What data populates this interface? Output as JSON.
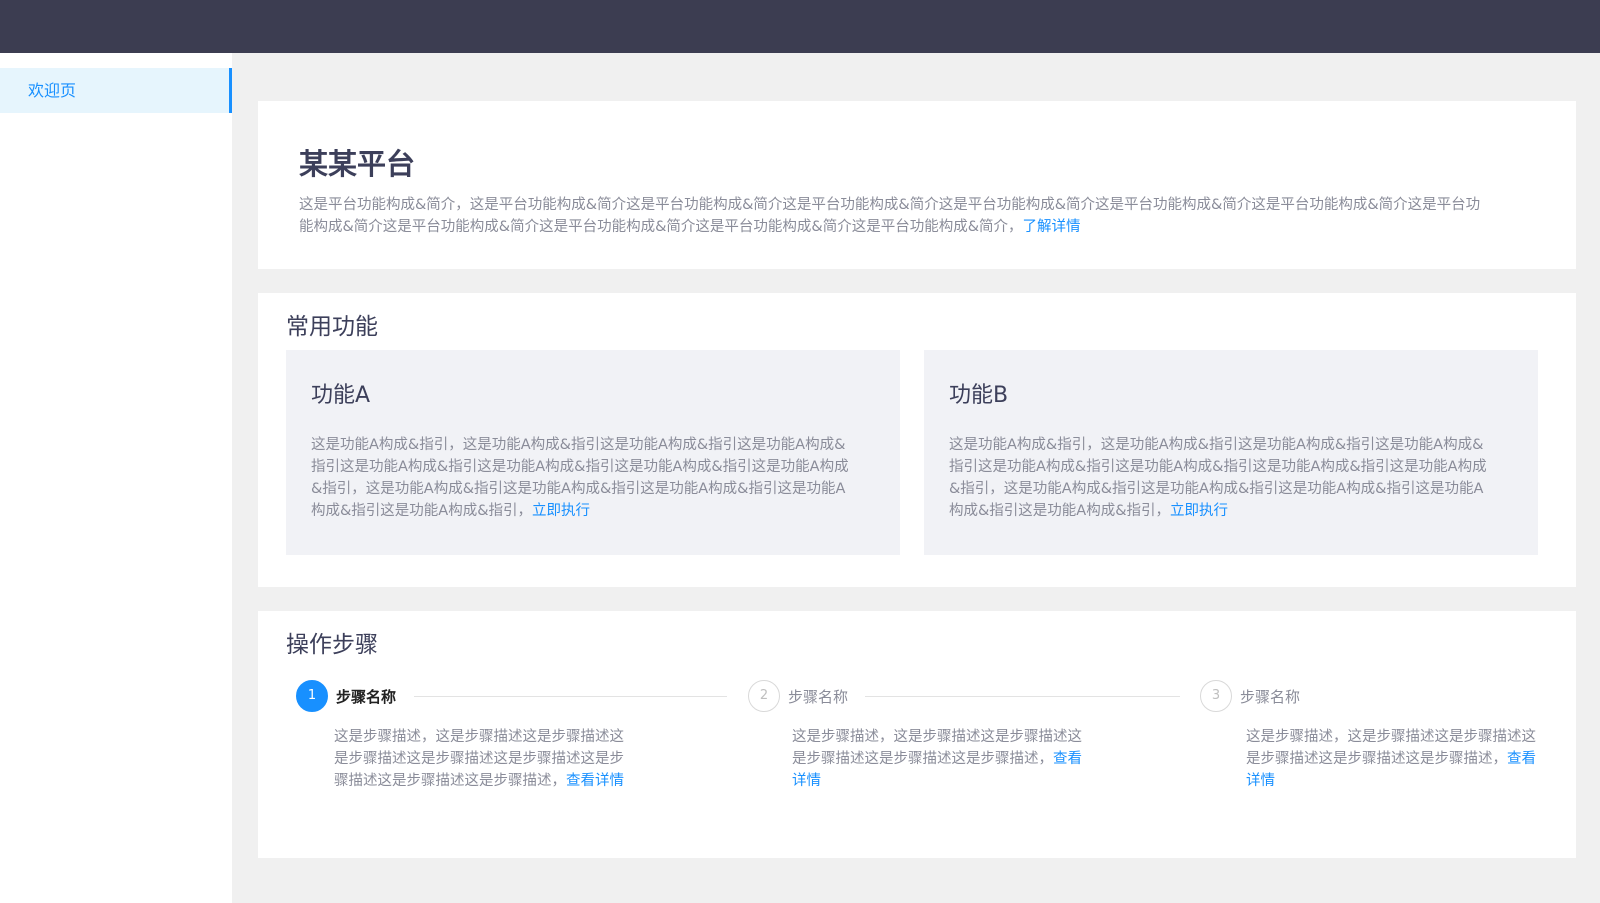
{
  "sidebar": {
    "items": [
      {
        "label": "欢迎页",
        "active": true
      }
    ]
  },
  "intro": {
    "title": "某某平台",
    "text": "这是平台功能构成&简介，这是平台功能构成&简介这是平台功能构成&简介这是平台功能构成&简介这是平台功能构成&简介这是平台功能构成&简介这是平台功能构成&简介这是平台功能构成&简介这是平台功能构成&简介这是平台功能构成&简介这是平台功能构成&简介这是平台功能构成&简介，",
    "link": "了解详情"
  },
  "functions": {
    "title": "常用功能",
    "cards": [
      {
        "title": "功能A",
        "text": "这是功能A构成&指引，这是功能A构成&指引这是功能A构成&指引这是功能A构成&指引这是功能A构成&指引这是功能A构成&指引这是功能A构成&指引这是功能A构成&指引，这是功能A构成&指引这是功能A构成&指引这是功能A构成&指引这是功能A构成&指引这是功能A构成&指引，",
        "link": "立即执行"
      },
      {
        "title": "功能B",
        "text": "这是功能A构成&指引，这是功能A构成&指引这是功能A构成&指引这是功能A构成&指引这是功能A构成&指引这是功能A构成&指引这是功能A构成&指引这是功能A构成&指引，这是功能A构成&指引这是功能A构成&指引这是功能A构成&指引这是功能A构成&指引这是功能A构成&指引，",
        "link": "立即执行"
      }
    ]
  },
  "steps": {
    "title": "操作步骤",
    "items": [
      {
        "number": "1",
        "name": "步骤名称",
        "active": true,
        "desc": "这是步骤描述，这是步骤描述这是步骤描述这是步骤描述这是步骤描述这是步骤描述这是步骤描述这是步骤描述这是步骤描述，",
        "link": "查看详情"
      },
      {
        "number": "2",
        "name": "步骤名称",
        "active": false,
        "desc": "这是步骤描述，这是步骤描述这是步骤描述这是步骤描述这是步骤描述这是步骤描述，",
        "link": "查看详情"
      },
      {
        "number": "3",
        "name": "步骤名称",
        "active": false,
        "desc": "这是步骤描述，这是步骤描述这是步骤描述这是步骤描述这是步骤描述这是步骤描述，",
        "link": "查看详情"
      }
    ]
  },
  "colors": {
    "topbar": "#3c3d51",
    "accent": "#1890ff",
    "sidebar_active_bg": "#e6f5fd"
  }
}
